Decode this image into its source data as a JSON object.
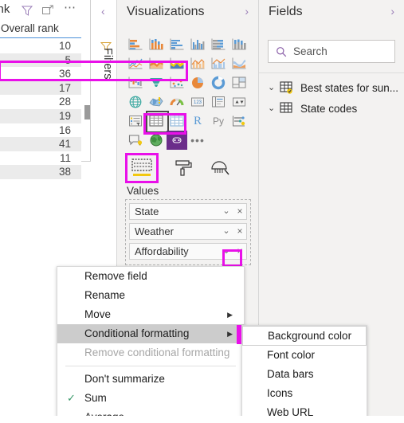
{
  "table_visual": {
    "title": "ank",
    "column_header": "Overall rank",
    "values": [
      10,
      5,
      36,
      17,
      28,
      19,
      16,
      41,
      11,
      38
    ],
    "icons": {
      "filter": "filter-icon",
      "focus": "focus-mode-icon",
      "more": "more-options-icon"
    }
  },
  "filters_rail": {
    "label": "Filters",
    "collapse_glyph": "‹",
    "funnel_icon": "filter-funnel-icon"
  },
  "visualizations": {
    "title": "Visualizations",
    "chevron": "›",
    "icons": [
      "stacked-bar-chart-icon",
      "stacked-column-chart-icon",
      "clustered-bar-chart-icon",
      "clustered-column-chart-icon",
      "100-stacked-bar-chart-icon",
      "100-stacked-column-chart-icon",
      "line-chart-icon",
      "area-chart-icon",
      "stacked-area-chart-icon",
      "line-stacked-column-chart-icon",
      "line-clustered-column-chart-icon",
      "ribbon-chart-icon",
      "waterfall-chart-icon",
      "funnel-chart-icon",
      "scatter-chart-icon",
      "pie-chart-icon",
      "donut-chart-icon",
      "treemap-icon",
      "map-icon",
      "filled-map-icon",
      "gauge-icon",
      "card-icon",
      "multi-row-card-icon",
      "kpi-icon",
      "slicer-icon",
      "table-icon",
      "matrix-icon",
      "r-script-visual-icon",
      "python-visual-icon",
      "key-influencers-icon",
      "q-and-a-icon",
      "arcgis-map-icon",
      "paginated-report-icon",
      "more-visuals-icon"
    ],
    "selected_icon": "table-icon",
    "format_tabs": [
      {
        "name": "fields-tab",
        "label": "Values",
        "selected": true
      },
      {
        "name": "format-paintbrush-tab",
        "label": "",
        "selected": false
      },
      {
        "name": "analytics-tab",
        "label": "",
        "selected": false
      }
    ],
    "values_label": "Values",
    "wells": [
      {
        "name": "State",
        "chevron": "⌄",
        "remove": "×"
      },
      {
        "name": "Weather",
        "chevron": "⌄",
        "remove": "×"
      },
      {
        "name": "Affordability",
        "chevron": "⌄",
        "remove": "×",
        "chevron_highlighted": true
      }
    ]
  },
  "fields": {
    "title": "Fields",
    "chevron": "›",
    "search": {
      "placeholder": "Search",
      "value": "",
      "icon": "search-icon"
    },
    "tables": [
      {
        "label": "Best states for sun...",
        "expand": "⌄",
        "icon": "table-icon",
        "badge": "checked-badge"
      },
      {
        "label": "State codes",
        "expand": "⌄",
        "icon": "table-icon",
        "badge": ""
      }
    ]
  },
  "context_menu": {
    "items": [
      {
        "label": "Remove field",
        "submenu": false,
        "checked": false,
        "disabled": false,
        "highlighted": false
      },
      {
        "label": "Rename",
        "submenu": false,
        "checked": false,
        "disabled": false,
        "highlighted": false
      },
      {
        "label": "Move",
        "submenu": true,
        "checked": false,
        "disabled": false,
        "highlighted": false
      },
      {
        "label": "Conditional formatting",
        "submenu": true,
        "checked": false,
        "disabled": false,
        "highlighted": true
      },
      {
        "label": "Remove conditional formatting",
        "submenu": false,
        "checked": false,
        "disabled": true,
        "highlighted": false
      },
      {
        "label": "Don't summarize",
        "submenu": false,
        "checked": false,
        "disabled": false,
        "highlighted": false
      },
      {
        "label": "Sum",
        "submenu": false,
        "checked": true,
        "disabled": false,
        "highlighted": false
      },
      {
        "label": "Average",
        "submenu": false,
        "checked": false,
        "disabled": false,
        "highlighted": false
      }
    ],
    "submenu_arrow": "▶",
    "check_glyph": "✓"
  },
  "sub_menu": {
    "items": [
      {
        "label": "Background color",
        "focused": true
      },
      {
        "label": "Font color",
        "focused": false
      },
      {
        "label": "Data bars",
        "focused": false
      },
      {
        "label": "Icons",
        "focused": false
      },
      {
        "label": "Web URL",
        "focused": false
      }
    ]
  },
  "colors": {
    "highlight_magenta": "#e910e9",
    "pane_background": "#f3f2f1",
    "menu_highlight": "#cccccc",
    "header_underline": "#4a90d9",
    "alt_row": "#ebebeb",
    "purple_visual": "#6b2d8a",
    "check_green": "#3a9a6a"
  }
}
